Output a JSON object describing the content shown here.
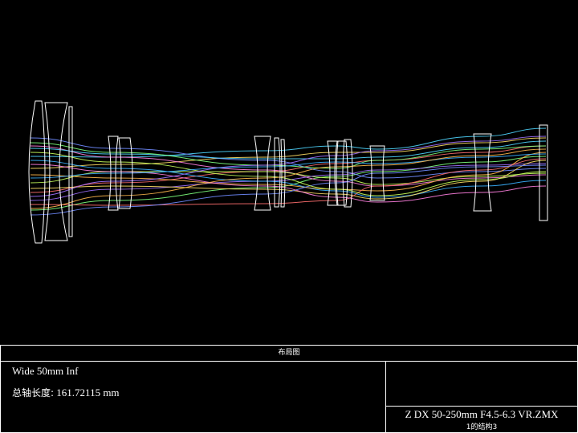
{
  "plot": {
    "ray_colors": [
      "#4fd6ff",
      "#ffe066",
      "#ff6f6f",
      "#7dff7d",
      "#6f8bff",
      "#ff7fe0",
      "#c7ff5a",
      "#a070ff",
      "#3ab0ff",
      "#ffb84d"
    ],
    "lens_color": "#ffffff"
  },
  "info": {
    "header": "布局图",
    "config_name": "Wide 50mm Inf",
    "length_label": "总轴长度:",
    "length_value": "161.72115 mm",
    "file_name": "Z DX 50-250mm F4.5-6.3 VR.ZMX",
    "config_number": "1的结构3"
  }
}
